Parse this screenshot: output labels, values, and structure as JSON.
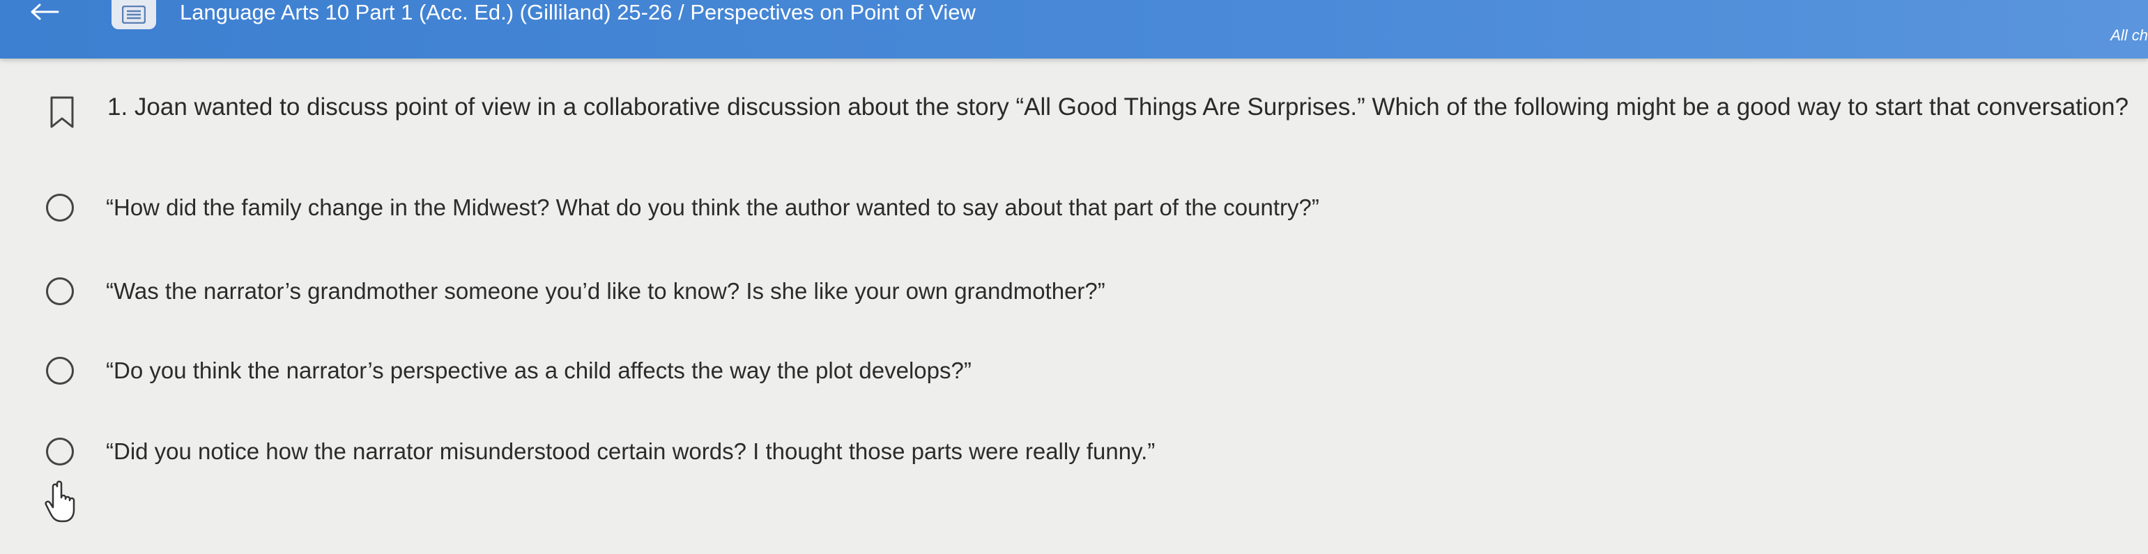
{
  "header": {
    "course_title": "Language Arts 10 Part 1 (Acc. Ed.) (Gilliland) 25-26 / Perspectives on Point of View",
    "right_link": "All ch",
    "back_icon": "arrow-left-icon",
    "menu_icon": "list-menu-icon"
  },
  "question": {
    "bookmark_icon": "bookmark-icon",
    "text": "1. Joan wanted to discuss point of view in a collaborative discussion about the story “All Good Things Are Surprises.” Which of the following might be a good way to start that conversation?",
    "options": [
      {
        "label": "“How did the family change in the Midwest? What do you think the author wanted to say about that part of the country?”"
      },
      {
        "label": "“Was the narrator’s grandmother someone you’d like to know? Is she like your own grandmother?”"
      },
      {
        "label": "“Do you think the narrator’s perspective as a child affects the way the plot develops?”"
      },
      {
        "label": "“Did you notice how the narrator misunderstood certain words? I thought those parts were really funny.”"
      }
    ]
  },
  "colors": {
    "header_blue": "#4a8ad8",
    "page_background": "#eeeeec",
    "text": "#2b2b2b"
  }
}
